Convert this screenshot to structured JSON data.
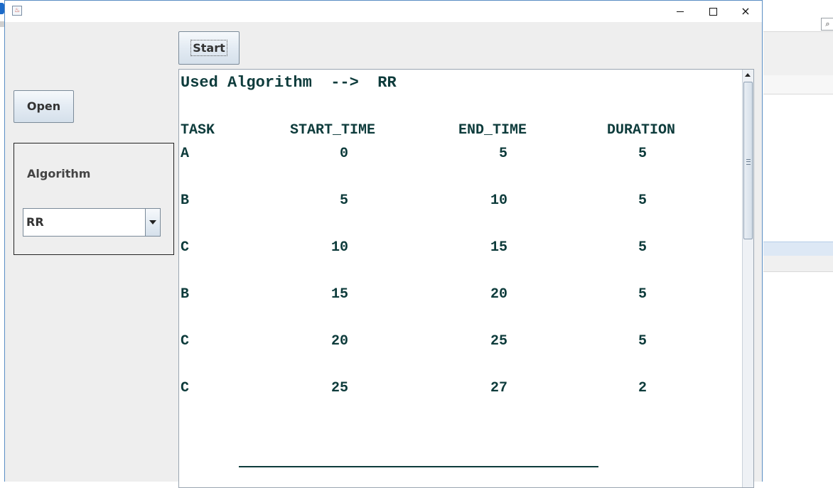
{
  "window": {
    "title": "",
    "controls": {
      "minimize": "minimize",
      "maximize": "maximize",
      "close": "×"
    }
  },
  "left_panel": {
    "open_label": "Open",
    "algorithm": {
      "label": "Algorithm",
      "selected": "RR"
    }
  },
  "toolbar": {
    "start_label": "Start"
  },
  "output": {
    "algorithm_line": "Used Algorithm  -->  RR",
    "headers": [
      "TASK",
      "START_TIME",
      "END_TIME",
      "DURATION"
    ],
    "rows": [
      [
        "A",
        "0",
        "5",
        "5"
      ],
      [
        "B",
        "5",
        "10",
        "5"
      ],
      [
        "C",
        "10",
        "15",
        "5"
      ],
      [
        "B",
        "15",
        "20",
        "5"
      ],
      [
        "C",
        "20",
        "25",
        "5"
      ],
      [
        "C",
        "25",
        "27",
        "2"
      ]
    ]
  },
  "icons": [
    "java-app-icon",
    "minimize-icon",
    "maximize-icon",
    "close-icon",
    "dropdown-arrow-icon",
    "scroll-up-icon",
    "search-icon"
  ],
  "colors": {
    "output_text": "#0d3b3b",
    "window_border": "#5a8ec4",
    "panel_bg": "#eeeeee"
  }
}
